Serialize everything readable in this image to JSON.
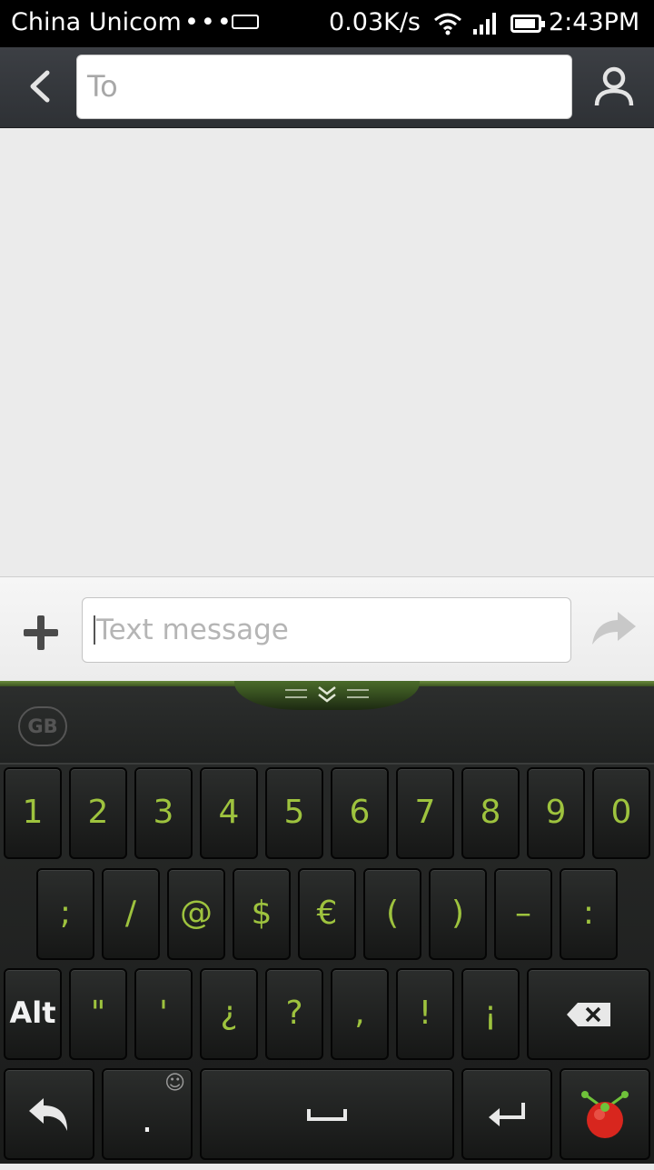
{
  "status_bar": {
    "carrier": "China Unicom",
    "dots": "•••",
    "net_speed": "0.03K/s",
    "time": "2:43PM"
  },
  "header": {
    "back_icon": "chevron-left-icon",
    "to_placeholder": "To",
    "contact_icon": "person-icon"
  },
  "composer": {
    "attach_icon": "plus-icon",
    "message_placeholder": "Text message",
    "send_icon": "send-arrow-icon"
  },
  "keyboard": {
    "logo": "GB",
    "row1": [
      "1",
      "2",
      "3",
      "4",
      "5",
      "6",
      "7",
      "8",
      "9",
      "0"
    ],
    "row2": [
      ";",
      "/",
      "@",
      "$",
      "€",
      "(",
      ")",
      "–",
      ":"
    ],
    "row3": [
      "Alt",
      "\"",
      "'",
      "¿",
      "?",
      ",",
      "!",
      "¡"
    ],
    "row4": {
      "period": ".",
      "smiley": "☺"
    },
    "accent_color": "#9ec33e"
  }
}
